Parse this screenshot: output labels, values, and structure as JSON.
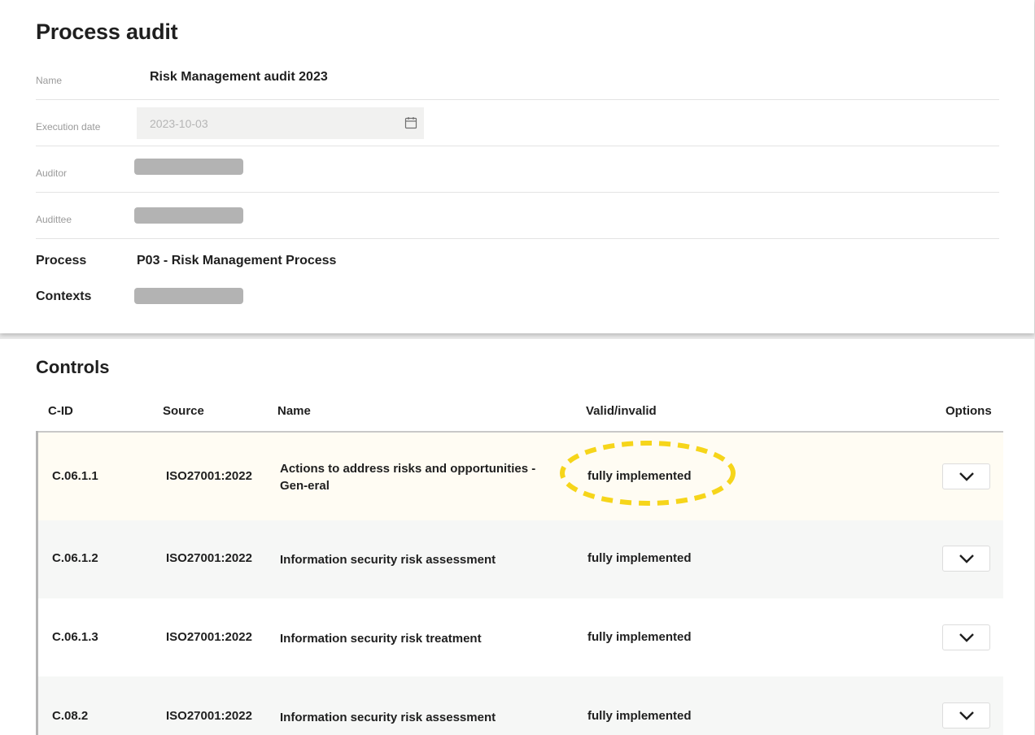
{
  "header": {
    "title": "Process audit"
  },
  "fields": {
    "name": {
      "label": "Name",
      "value": "Risk Management audit 2023"
    },
    "execution_date": {
      "label": "Execution date",
      "value": "2023-10-03"
    },
    "auditor": {
      "label": "Auditor"
    },
    "auditee": {
      "label": "Audittee"
    },
    "process": {
      "label": "Process",
      "value": "P03 - Risk Management Process"
    },
    "contexts": {
      "label": "Contexts"
    }
  },
  "controls": {
    "title": "Controls",
    "columns": {
      "cid": "C-ID",
      "source": "Source",
      "name": "Name",
      "valid": "Valid/invalid",
      "options": "Options"
    },
    "rows": [
      {
        "cid": "C.06.1.1",
        "source": "ISO27001:2022",
        "name": "Actions to address risks and opportunities - Gen-eral",
        "valid": "fully implemented",
        "background": "#fffcf3"
      },
      {
        "cid": "C.06.1.2",
        "source": "ISO27001:2022",
        "name": "Information security risk assessment",
        "valid": "fully implemented",
        "background": "#f6f7f6"
      },
      {
        "cid": "C.06.1.3",
        "source": "ISO27001:2022",
        "name": "Information security risk treatment",
        "valid": "fully implemented",
        "background": "#ffffff"
      },
      {
        "cid": "C.08.2",
        "source": "ISO27001:2022",
        "name": "Information security risk assessment",
        "valid": "fully implemented",
        "background": "#f6f7f6"
      }
    ]
  },
  "colors": {
    "highlight": "#f6d51a",
    "redacted": "#b3b3b3",
    "date_input_bg": "#f1f1f0"
  },
  "icons": {
    "date_picker": "calendar-icon",
    "row_option": "chevron-down-icon"
  }
}
